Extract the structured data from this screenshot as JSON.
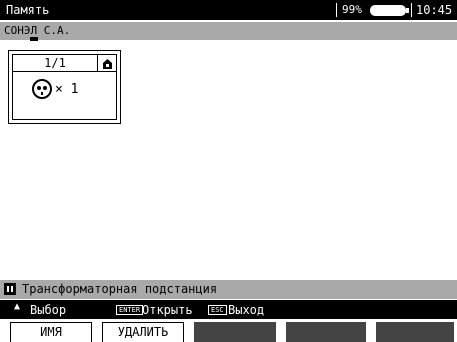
{
  "status": {
    "title": "Память",
    "battery_percent": "99%",
    "time": "10:45"
  },
  "path": {
    "label": "СОНЭЛ С.А."
  },
  "folder_card": {
    "pager": "1/1",
    "socket_count": "× 1"
  },
  "info": {
    "object_name": "Трансформаторная подстанция"
  },
  "hints": {
    "select": "Выбор",
    "enter_key": "ENTER",
    "open": "Открыть",
    "esc_key": "ESC",
    "exit": "Выход"
  },
  "softkeys": {
    "name": "ИМЯ",
    "delete": "УДАЛИТЬ"
  },
  "colors": {
    "bar_dark": "#000000",
    "bar_gray": "#a9a9a9",
    "softkey_inactive": "#444444"
  },
  "icons": [
    "lock-icon",
    "socket-icon",
    "battery-icon",
    "signal-icon",
    "up-arrow-icon"
  ]
}
